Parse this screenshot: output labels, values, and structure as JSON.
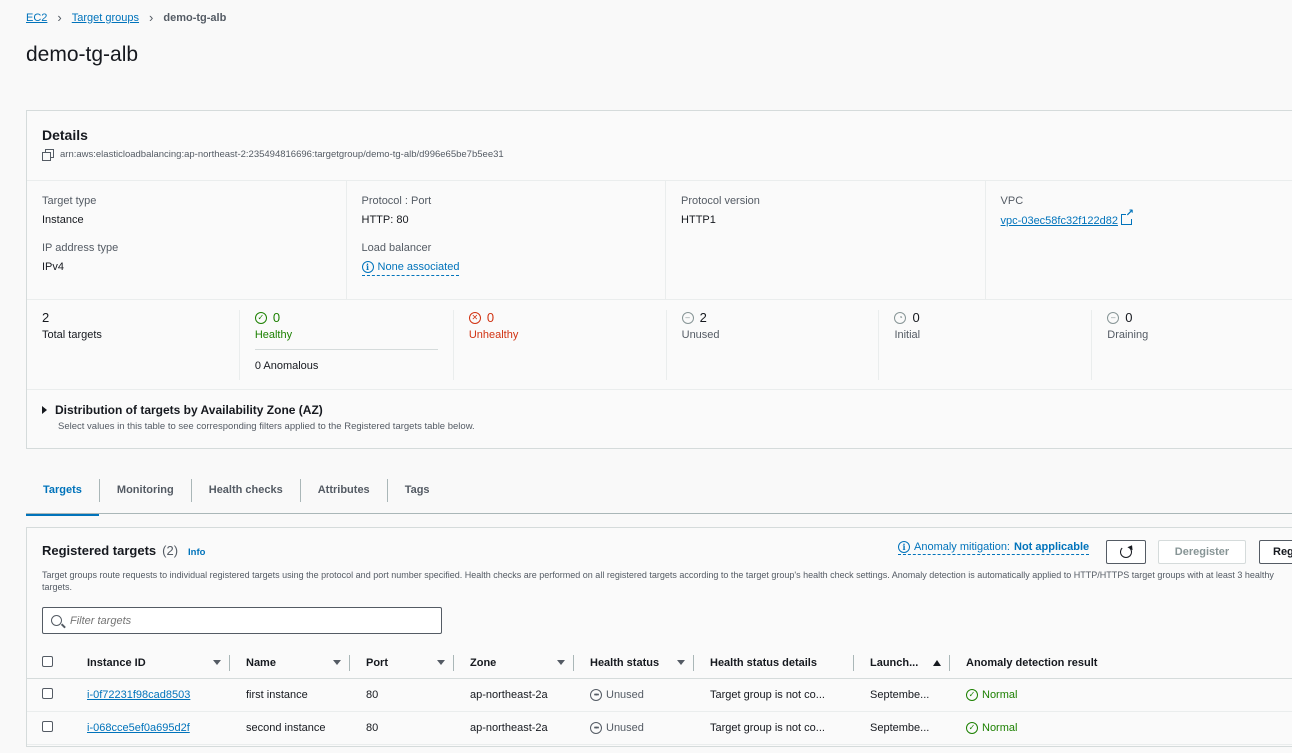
{
  "breadcrumb": {
    "root": "EC2",
    "parent": "Target groups",
    "current": "demo-tg-alb"
  },
  "page_title": "demo-tg-alb",
  "details": {
    "heading": "Details",
    "arn": "arn:aws:elasticloadbalancing:ap-northeast-2:235494816696:targetgroup/demo-tg-alb/d996e65be7b5ee31",
    "target_type_label": "Target type",
    "target_type": "Instance",
    "ip_type_label": "IP address type",
    "ip_type": "IPv4",
    "protocol_port_label": "Protocol : Port",
    "protocol_port": "HTTP: 80",
    "load_balancer_label": "Load balancer",
    "load_balancer": "None associated",
    "protocol_version_label": "Protocol version",
    "protocol_version": "HTTP1",
    "vpc_label": "VPC",
    "vpc": "vpc-03ec58fc32f122d82"
  },
  "counts": {
    "total": "2",
    "total_label": "Total targets",
    "healthy": "0",
    "healthy_label": "Healthy",
    "anomalous": "0 Anomalous",
    "unhealthy": "0",
    "unhealthy_label": "Unhealthy",
    "unused": "2",
    "unused_label": "Unused",
    "initial": "0",
    "initial_label": "Initial",
    "draining": "0",
    "draining_label": "Draining"
  },
  "distribution": {
    "title": "Distribution of targets by Availability Zone (AZ)",
    "subtitle": "Select values in this table to see corresponding filters applied to the Registered targets table below."
  },
  "tabs": [
    "Targets",
    "Monitoring",
    "Health checks",
    "Attributes",
    "Tags"
  ],
  "registered": {
    "title": "Registered targets",
    "count": "(2)",
    "info": "Info",
    "description": "Target groups route requests to individual registered targets using the protocol and port number specified. Health checks are performed on all registered targets according to the target group's health check settings. Anomaly detection is automatically applied to HTTP/HTTPS target groups with at least 3 healthy targets.",
    "anomaly_label": "Anomaly mitigation:",
    "anomaly_value": "Not applicable",
    "deregister": "Deregister",
    "register": "Register targets",
    "filter_placeholder": "Filter targets",
    "columns": [
      "Instance ID",
      "Name",
      "Port",
      "Zone",
      "Health status",
      "Health status details",
      "Launch...",
      "Anomaly detection result"
    ],
    "rows": [
      {
        "id": "i-0f72231f98cad8503",
        "name": "first instance",
        "port": "80",
        "zone": "ap-northeast-2a",
        "health": "Unused",
        "details": "Target group is not co...",
        "launch": "Septembe...",
        "anomaly": "Normal"
      },
      {
        "id": "i-068cce5ef0a695d2f",
        "name": "second instance",
        "port": "80",
        "zone": "ap-northeast-2a",
        "health": "Unused",
        "details": "Target group is not co...",
        "launch": "Septembe...",
        "anomaly": "Normal"
      }
    ]
  },
  "colors": {
    "link": "#0073bb",
    "healthy": "#1d8102",
    "unhealthy": "#d13212"
  }
}
